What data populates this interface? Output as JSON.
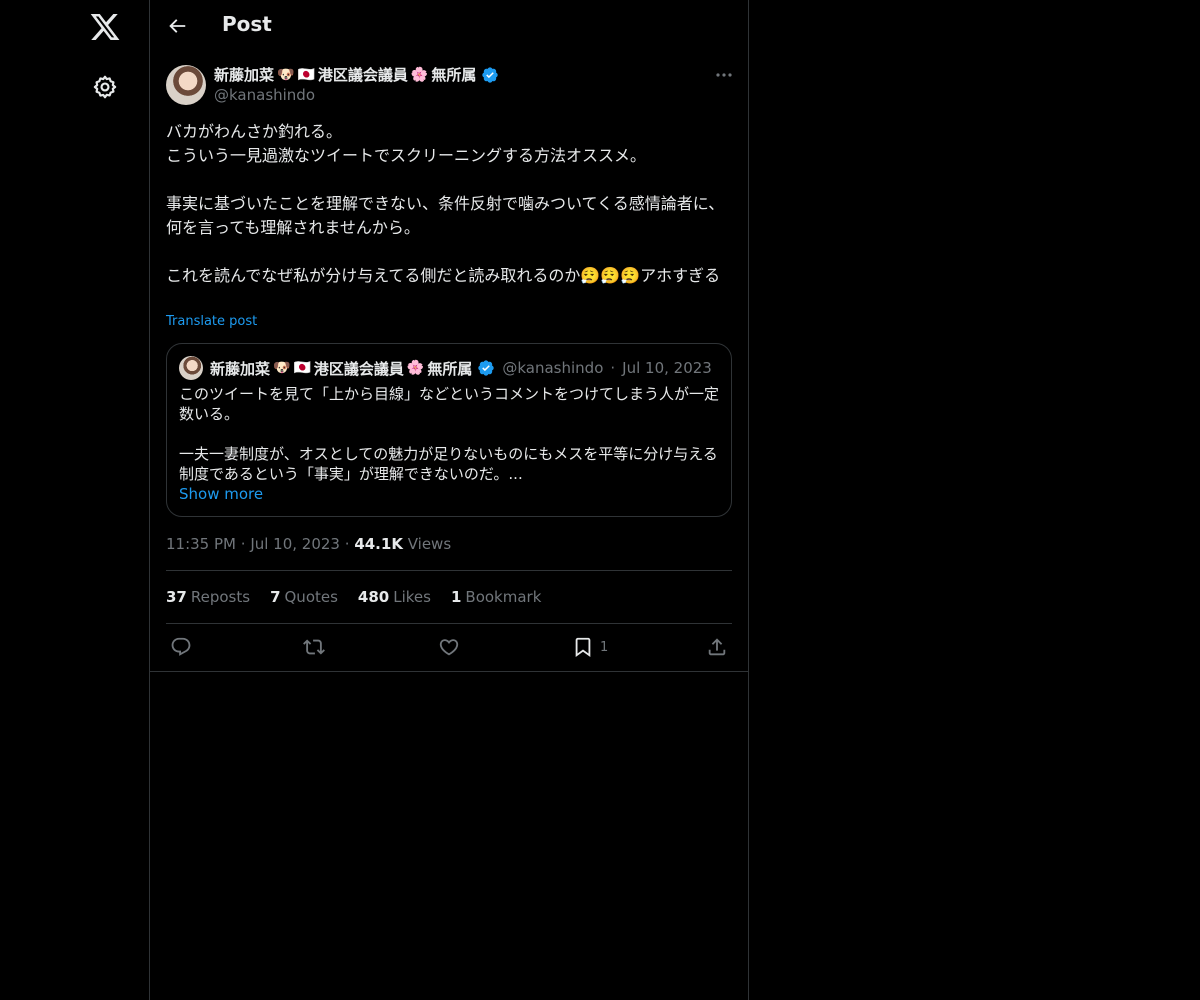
{
  "nav": {
    "logo_icon": "x-logo-icon",
    "settings_icon": "gear-icon"
  },
  "header": {
    "title": "Post",
    "back_icon": "arrow-left-icon"
  },
  "post": {
    "author_name": "新藤加菜",
    "author_name_suffix_1": "港区議会議員",
    "author_name_suffix_2": "無所属",
    "handle": "@kanashindo",
    "text": "バカがわんさか釣れる。\nこういう一見過激なツイートでスクリーニングする方法オススメ。\n\n事実に基づいたことを理解できない、条件反射で噛みついてくる感情論者に、何を言っても理解されませんから。\n\nこれを読んでなぜ私が分け与えてる側だと読み取れるのか😮‍💨😮‍💨😮‍💨アホすぎる",
    "translate_label": "Translate post",
    "time": "11:35 PM",
    "date": "Jul 10, 2023",
    "views_count": "44.1K",
    "views_label": "Views"
  },
  "quote": {
    "author_name": "新藤加菜",
    "author_name_suffix_1": "港区議会議員",
    "author_name_suffix_2": "無所属",
    "handle": "@kanashindo",
    "date": "Jul 10, 2023",
    "text": "このツイートを見て「上から目線」などというコメントをつけてしまう人が一定数いる。\n\n一夫一妻制度が、オスとしての魅力が足りないものにもメスを平等に分け与える制度であるという「事実」が理解できないのだ。...",
    "show_more": "Show more"
  },
  "stats": {
    "reposts_count": "37",
    "reposts_label": "Reposts",
    "quotes_count": "7",
    "quotes_label": "Quotes",
    "likes_count": "480",
    "likes_label": "Likes",
    "bookmarks_count": "1",
    "bookmarks_label": "Bookmark"
  },
  "actions": {
    "bookmark_count": "1"
  },
  "colors": {
    "accent": "#1d9bf0",
    "muted": "#71767b",
    "text": "#e7e9ea",
    "border": "#2f3336"
  }
}
